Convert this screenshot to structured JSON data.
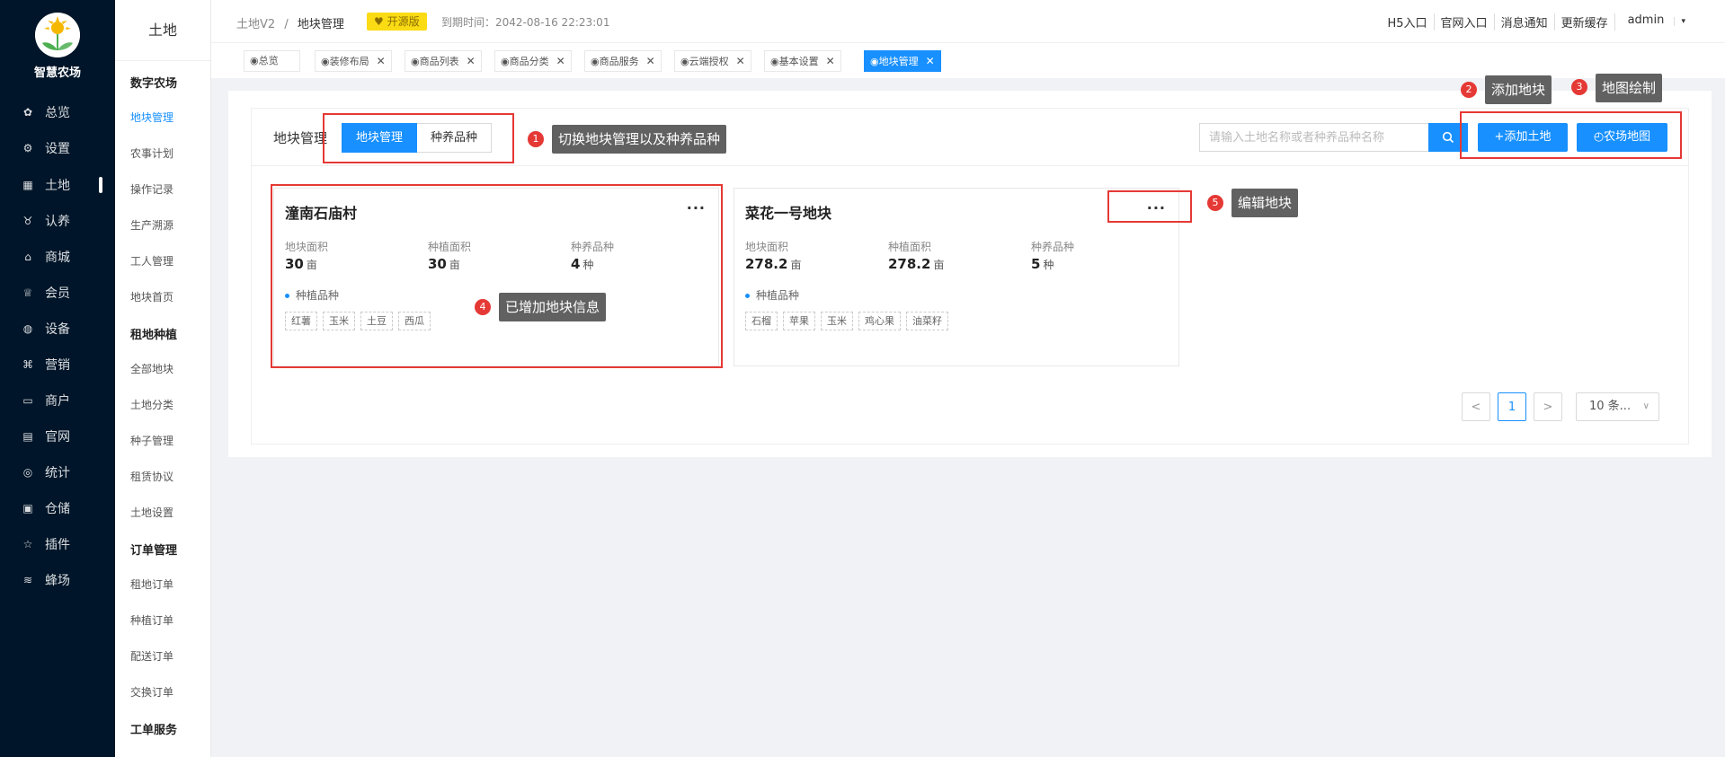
{
  "brand": {
    "name": "智慧农场"
  },
  "nav": [
    {
      "label": "总览",
      "icon": "dashboard-icon"
    },
    {
      "label": "设置",
      "icon": "gear-icon"
    },
    {
      "label": "土地",
      "icon": "grid-icon"
    },
    {
      "label": "认养",
      "icon": "cattle-icon"
    },
    {
      "label": "商城",
      "icon": "shop-icon"
    },
    {
      "label": "会员",
      "icon": "member-icon"
    },
    {
      "label": "设备",
      "icon": "device-icon"
    },
    {
      "label": "营销",
      "icon": "marketing-icon"
    },
    {
      "label": "商户",
      "icon": "merchant-icon"
    },
    {
      "label": "官网",
      "icon": "website-icon"
    },
    {
      "label": "统计",
      "icon": "stats-icon"
    },
    {
      "label": "仓储",
      "icon": "warehouse-icon"
    },
    {
      "label": "插件",
      "icon": "star-icon"
    },
    {
      "label": "蜂场",
      "icon": "bee-icon"
    }
  ],
  "subnav": {
    "title": "土地",
    "groups": [
      {
        "label": "数字农场"
      },
      {
        "label": "租地种植"
      },
      {
        "label": "订单管理"
      },
      {
        "label": "工单服务"
      }
    ],
    "items": [
      {
        "label": "地块管理"
      },
      {
        "label": "农事计划"
      },
      {
        "label": "操作记录"
      },
      {
        "label": "生产溯源"
      },
      {
        "label": "工人管理"
      },
      {
        "label": "地块首页"
      },
      {
        "label": "全部地块"
      },
      {
        "label": "土地分类"
      },
      {
        "label": "种子管理"
      },
      {
        "label": "租赁协议"
      },
      {
        "label": "土地设置"
      },
      {
        "label": "租地订单"
      },
      {
        "label": "种植订单"
      },
      {
        "label": "配送订单"
      },
      {
        "label": "交换订单"
      }
    ]
  },
  "header": {
    "crumb_root": "土地V2",
    "crumb_sep": "/",
    "crumb_current": "地块管理",
    "badge": "开源版",
    "expire": "到期时间：2042-08-16 22:23:01",
    "links": [
      "H5入口",
      "官网入口",
      "消息通知",
      "更新缓存",
      "admin"
    ]
  },
  "tabs": [
    {
      "label": "◉总览"
    },
    {
      "label": "◉装修布局"
    },
    {
      "label": "◉商品列表"
    },
    {
      "label": "◉商品分类"
    },
    {
      "label": "◉商品服务"
    },
    {
      "label": "◉云端授权"
    },
    {
      "label": "◉基本设置"
    },
    {
      "label": "◉地块管理"
    }
  ],
  "main": {
    "section_label": "地块管理",
    "toggle": [
      "地块管理",
      "种养品种"
    ],
    "search_placeholder": "请输入土地名称或者种养品种名称",
    "add_button": "+添加土地",
    "map_button": "农场地图"
  },
  "cards": [
    {
      "title": "潼南石庙村",
      "more": "···",
      "stats": [
        {
          "label": "地块面积",
          "value": "30",
          "unit": "亩"
        },
        {
          "label": "种植面积",
          "value": "30",
          "unit": "亩"
        },
        {
          "label": "种养品种",
          "value": "4",
          "unit": "种"
        }
      ],
      "crop_label": "种植品种",
      "crops": [
        "红薯",
        "玉米",
        "土豆",
        "西瓜"
      ]
    },
    {
      "title": "菜花一号地块",
      "more": "···",
      "stats": [
        {
          "label": "地块面积",
          "value": "278.2",
          "unit": "亩"
        },
        {
          "label": "种植面积",
          "value": "278.2",
          "unit": "亩"
        },
        {
          "label": "种养品种",
          "value": "5",
          "unit": "种"
        }
      ],
      "crop_label": "种植品种",
      "crops": [
        "石榴",
        "苹果",
        "玉米",
        "鸡心果",
        "油菜籽"
      ]
    }
  ],
  "pagination": {
    "prev": "<",
    "current": "1",
    "next": ">",
    "page_size": "10 条..."
  },
  "annotations": [
    {
      "num": "1",
      "text": "切换地块管理以及种养品种"
    },
    {
      "num": "2",
      "text": "添加地块"
    },
    {
      "num": "3",
      "text": "地图绘制"
    },
    {
      "num": "4",
      "text": "已增加地块信息"
    },
    {
      "num": "5",
      "text": "编辑地块"
    }
  ],
  "colors": {
    "sidebar": "#001529",
    "primary": "#1890ff",
    "annotation": "#e53935",
    "badge": "#fadb14"
  }
}
